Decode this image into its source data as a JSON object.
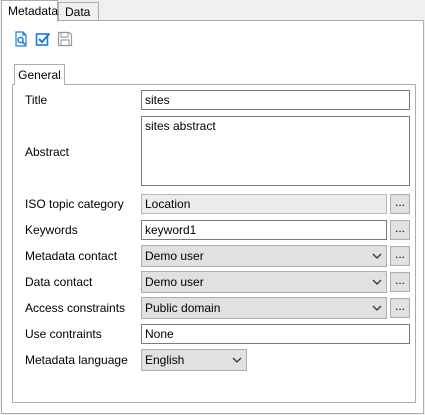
{
  "tabs": [
    {
      "label": "Metadata",
      "active": true
    },
    {
      "label": "Data",
      "active": false
    }
  ],
  "toolbar": [
    {
      "icon": "search-document-icon",
      "color": "#1e7bd6"
    },
    {
      "icon": "checkbox-validate-icon",
      "color": "#1e7bd6"
    },
    {
      "icon": "save-disk-icon",
      "color": "#9a9a9a"
    }
  ],
  "inner_tab": {
    "label": "General"
  },
  "form": {
    "title": {
      "label": "Title",
      "value": "sites"
    },
    "abstract": {
      "label": "Abstract",
      "value": "sites abstract"
    },
    "iso_topic": {
      "label": "ISO topic category",
      "value": "Location",
      "button": "..."
    },
    "keywords": {
      "label": "Keywords",
      "value": "keyword1",
      "button": "..."
    },
    "metadata_contact": {
      "label": "Metadata contact",
      "value": "Demo user",
      "button": "..."
    },
    "data_contact": {
      "label": "Data contact",
      "value": "Demo user",
      "button": "..."
    },
    "access_constraints": {
      "label": "Access constraints",
      "value": "Public domain",
      "button": "..."
    },
    "use_constraints": {
      "label": "Use contraints",
      "value": "None"
    },
    "metadata_language": {
      "label": "Metadata language",
      "value": "English"
    }
  }
}
